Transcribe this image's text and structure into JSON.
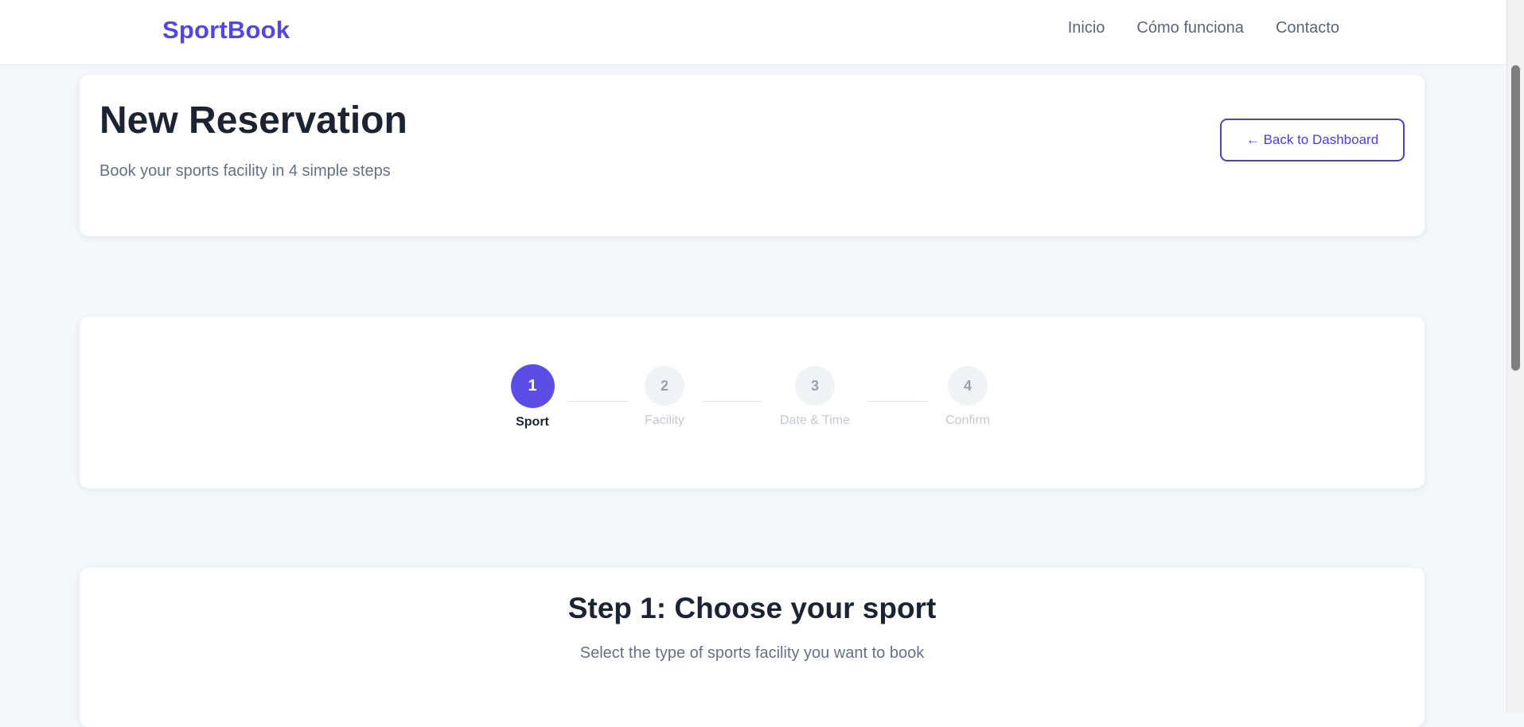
{
  "nav": {
    "brand": "SportBook",
    "links": [
      "Inicio",
      "Cómo funciona",
      "Contacto"
    ]
  },
  "header": {
    "title": "New Reservation",
    "subtitle": "Book your sports facility in 4 simple steps",
    "back_button": "← Back to Dashboard"
  },
  "stepper": {
    "current_step": 1,
    "steps": [
      {
        "number": "1",
        "label": "Sport"
      },
      {
        "number": "2",
        "label": "Facility"
      },
      {
        "number": "3",
        "label": "Date & Time"
      },
      {
        "number": "4",
        "label": "Confirm"
      }
    ]
  },
  "content": {
    "title": "Step 1: Choose your sport",
    "subtitle": "Select the type of sports facility you want to book"
  },
  "colors": {
    "accent": "#5b4de6",
    "brand": "#5346e2",
    "background": "#f5f6f9"
  }
}
